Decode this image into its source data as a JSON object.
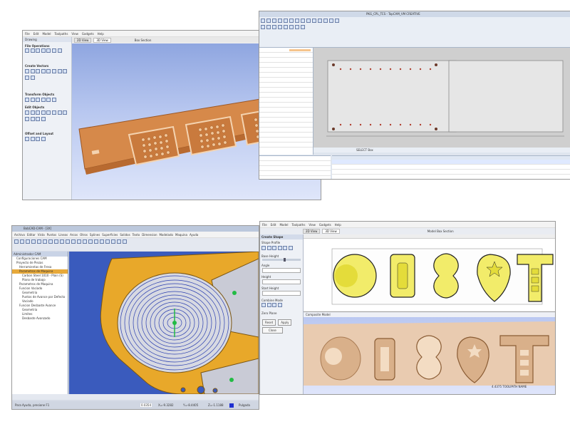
{
  "colors": {
    "wood": "#d6894a",
    "wood_dark": "#b86a30",
    "gold": "#e8a82a",
    "blue_path": "#2b3fb0",
    "shape_fill": "#f2ec6a",
    "shape_fill2": "#e4dc3a",
    "viewport_blue": "#3a5bbd",
    "carve": "#e9cbb0"
  },
  "panel1": {
    "menu": [
      "File",
      "Edit",
      "Model",
      "Toolpaths",
      "View",
      "Gadgets",
      "Help"
    ],
    "panel_title": "Drawing",
    "tab_2d": "2D View",
    "tab_3d": "3D View",
    "box_section": "Box Section",
    "sections": [
      "File Operations",
      "Create Vectors",
      "Transform Objects",
      "Edit Objects",
      "Offset and Layout"
    ]
  },
  "panel2": {
    "title": "PKG_CPL_TCS - TopCAM_VM CREATIVE",
    "status_text": "SELECT Box"
  },
  "panel3": {
    "title": "BobCAD-CAM - [3X]",
    "menu": [
      "Archivo",
      "Editar",
      "Vista",
      "Puntos",
      "Lineas",
      "Arcos",
      "Otros",
      "Splines",
      "Superficies",
      "Solidos",
      "Texto",
      "Dimension",
      "Modelado",
      "Maquina",
      "Ayuda"
    ],
    "tree_title": "Administrador CAM",
    "tree_items": [
      "Configuraciones CAM",
      "Proyecto de Piezas",
      "Herramientas de Fresa",
      "Parametros de Maquina",
      "Carbon Steel 1010 - Plain (S)",
      "Plano de trabajo",
      "Parametros de Maquina",
      "Funcion Vaciado",
      "Geometria",
      "Puntos de Avance por Defecto",
      "Vaciado",
      "Funcion Desbaste Avance",
      "Geometria",
      "Limites",
      "Desbaste Avanzado"
    ],
    "status_help": "Para Ayuda, presione F1",
    "coord_scale": "0.0354",
    "coord_x": "X=-9.3282",
    "coord_y": "Y=-8.4405",
    "coord_z": "Z=-1.1188",
    "units": "Pulgada"
  },
  "panel4": {
    "title": "Aspire - Shapes [1] - Create Shape Profile Tool",
    "menu": [
      "File",
      "Edit",
      "Model",
      "Toolpaths",
      "View",
      "Gadgets",
      "Help"
    ],
    "tab_2d": "2D View",
    "tab_3d": "3D View",
    "box_section": "Model Box Section",
    "tool_title": "Create Shape",
    "shape_profile": "Shape Profile",
    "base_height": "Base Height",
    "angle": "Angle",
    "height": "Height",
    "start_height": "Start Height",
    "combine_mode": "Combine Mode",
    "zero_plane": "Zero Plane",
    "reset": "Reset",
    "apply": "Apply",
    "close": "Close",
    "composite_label": "Composite Model",
    "dim_text": "4.4375 TOOLPATH NAME"
  }
}
